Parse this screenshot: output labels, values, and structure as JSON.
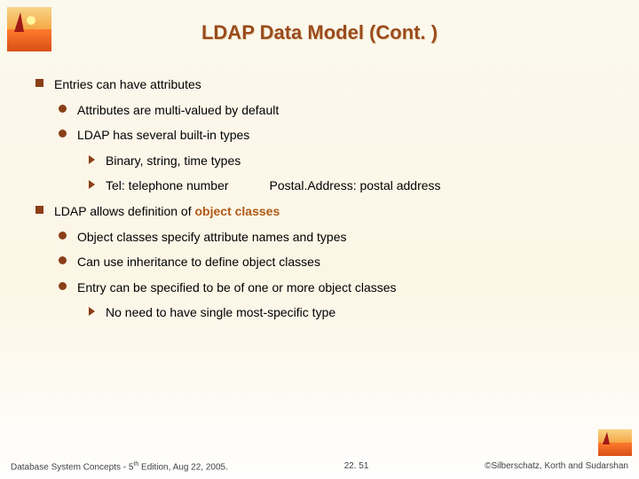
{
  "title": "LDAP Data Model (Cont. )",
  "bullets": {
    "b1": "Entries can have attributes",
    "b1a": "Attributes are multi-valued by default",
    "b1b": "LDAP has several built-in types",
    "b1b1": "Binary, string, time types",
    "b1b2a": "Tel:   telephone number",
    "b1b2b": "Postal.Address:  postal address",
    "b2a": "LDAP allows definition of ",
    "b2b": "object classes",
    "b2c1": "Object classes specify attribute names and types",
    "b2c2": "Can use inheritance to define object classes",
    "b2c3": "Entry can be specified to be of one or more object classes",
    "b2c3a": "No need to have single most-specific type"
  },
  "pageCorner": "51",
  "footer": {
    "left": "Database System Concepts - 5",
    "leftSup": "th",
    "leftTail": " Edition, Aug 22, 2005.",
    "center": "22. 51",
    "right": "©Silberschatz, Korth and Sudarshan"
  }
}
